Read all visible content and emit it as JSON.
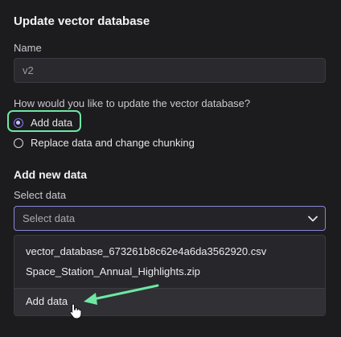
{
  "dialog": {
    "title": "Update vector database",
    "name_label": "Name",
    "name_value": "v2",
    "question": "How would you like to update the vector database?",
    "options": [
      {
        "label": "Add data",
        "selected": true
      },
      {
        "label": "Replace data and change chunking",
        "selected": false
      }
    ]
  },
  "add_section": {
    "title": "Add new data",
    "select_label": "Select data",
    "select_placeholder": "Select data",
    "dropdown_items": [
      "vector_database_673261b8c62e4a6da3562920.csv",
      "Space_Station_Annual_Highlights.zip"
    ],
    "add_data_action": "Add data"
  },
  "colors": {
    "accent": "#8a7bff",
    "highlight": "#6ee7a3",
    "background": "#1c1c1f"
  }
}
